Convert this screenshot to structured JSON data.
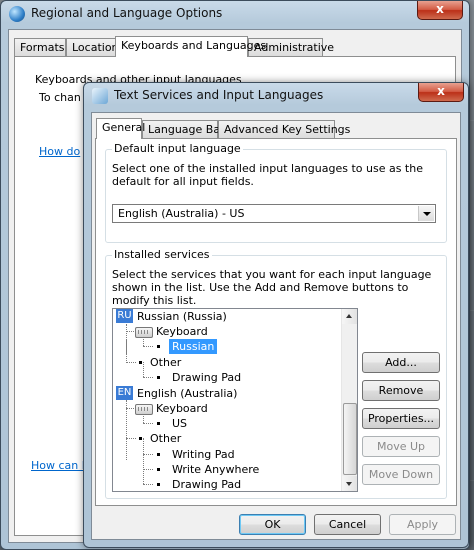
{
  "background_window": {
    "title": "Regional and Language Options",
    "close_label": "x",
    "tabs": [
      "Formats",
      "Location",
      "Keyboards and Languages",
      "Administrative"
    ],
    "active_tab_index": 2,
    "group_label": "Keyboards and other input languages",
    "partial_text": "To chan",
    "partial_link_1": "How do",
    "partial_link_2": "How can I"
  },
  "dialog": {
    "title": "Text Services and Input Languages",
    "close_label": "x",
    "tabs": [
      "General",
      "Language Bar",
      "Advanced Key Settings"
    ],
    "active_tab_index": 0,
    "default_input": {
      "legend": "Default input language",
      "description": "Select one of the installed input languages to use as the default for all input fields.",
      "selected_value": "English (Australia) - US"
    },
    "installed_services": {
      "legend": "Installed services",
      "description": "Select the services that you want for each input language shown in the list. Use the Add and Remove buttons to modify this list.",
      "tree": [
        {
          "type": "language",
          "badge": "RU",
          "label": "Russian (Russia)"
        },
        {
          "type": "category",
          "icon": "keyboard",
          "label": "Keyboard"
        },
        {
          "type": "item",
          "label": "Russian",
          "selected": true
        },
        {
          "type": "category",
          "icon": "bullet",
          "label": "Other"
        },
        {
          "type": "item",
          "label": "Drawing Pad"
        },
        {
          "type": "language",
          "badge": "EN",
          "label": "English (Australia)"
        },
        {
          "type": "category",
          "icon": "keyboard",
          "label": "Keyboard"
        },
        {
          "type": "item",
          "label": "US"
        },
        {
          "type": "category",
          "icon": "bullet",
          "label": "Other"
        },
        {
          "type": "item",
          "label": "Writing Pad"
        },
        {
          "type": "item",
          "label": "Write Anywhere"
        },
        {
          "type": "item",
          "label": "Drawing Pad"
        }
      ],
      "buttons": {
        "add": "Add...",
        "remove": "Remove",
        "properties": "Properties...",
        "move_up": "Move Up",
        "move_down": "Move Down"
      }
    },
    "footer": {
      "ok": "OK",
      "cancel": "Cancel",
      "apply": "Apply"
    }
  }
}
